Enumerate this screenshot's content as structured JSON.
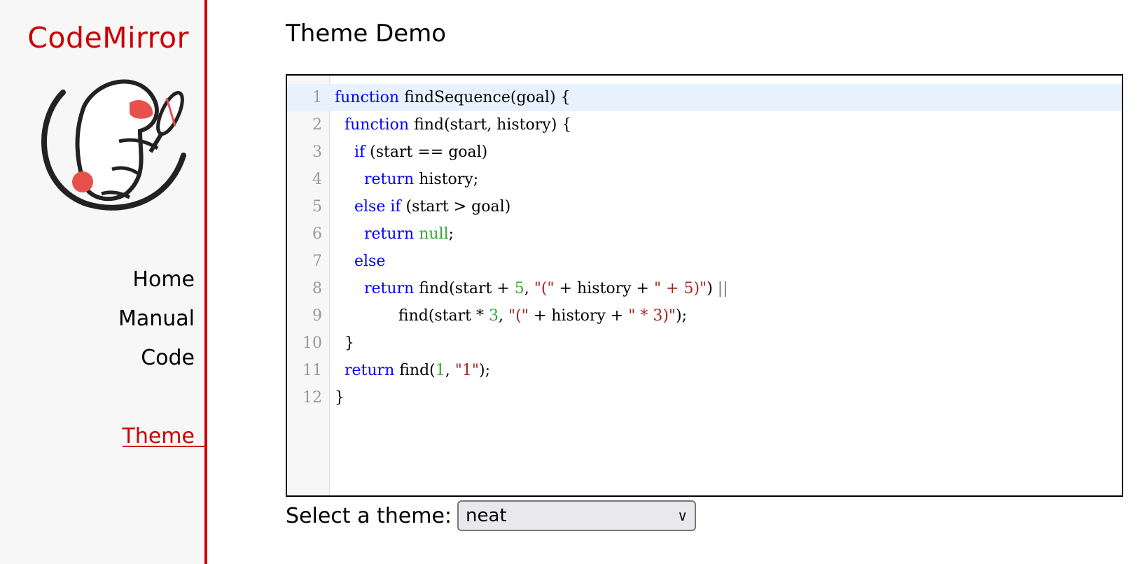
{
  "sidebar": {
    "logo_text": "CodeMirror",
    "nav": [
      {
        "label": "Home",
        "active": false
      },
      {
        "label": "Manual",
        "active": false
      },
      {
        "label": "Code",
        "active": false
      },
      {
        "label": "Theme",
        "active": true
      }
    ]
  },
  "main": {
    "title": "Theme Demo",
    "editor": {
      "active_line": 1,
      "line_numbers": [
        "1",
        "2",
        "3",
        "4",
        "5",
        "6",
        "7",
        "8",
        "9",
        "10",
        "11",
        "12"
      ],
      "lines": [
        "function findSequence(goal) {",
        "  function find(start, history) {",
        "    if (start == goal)",
        "      return history;",
        "    else if (start > goal)",
        "      return null;",
        "    else",
        "      return find(start + 5, \"(\" + history + \" + 5)\") ||",
        "             find(start * 3, \"(\" + history + \" * 3)\");",
        "  }",
        "  return find(1, \"1\");",
        "}"
      ]
    },
    "theme_select": {
      "label": "Select a theme:",
      "value": "neat"
    }
  },
  "colors": {
    "accent": "#cc0000",
    "keyword": "#0000ff",
    "number": "#33aa33",
    "string": "#aa2222",
    "active_line_bg": "#e8f2ff"
  }
}
